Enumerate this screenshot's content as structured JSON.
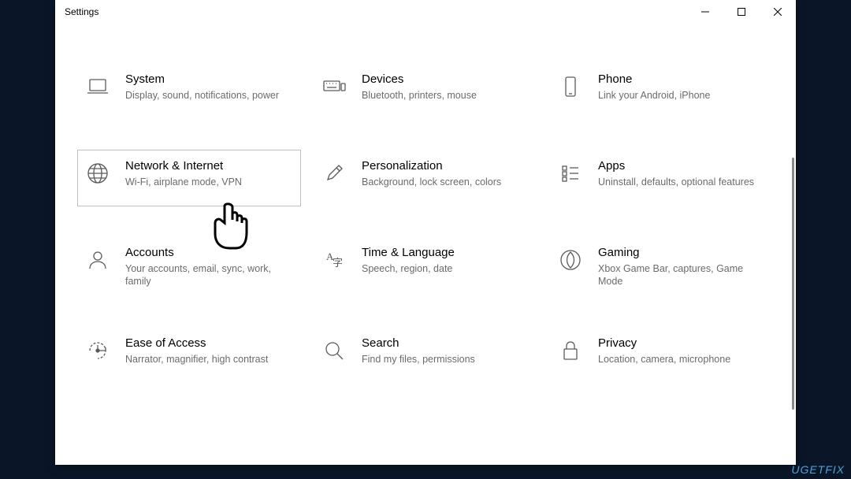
{
  "window": {
    "title": "Settings"
  },
  "tiles": [
    {
      "title": "System",
      "desc": "Display, sound, notifications, power",
      "icon": "laptop-icon"
    },
    {
      "title": "Devices",
      "desc": "Bluetooth, printers, mouse",
      "icon": "keyboard-icon"
    },
    {
      "title": "Phone",
      "desc": "Link your Android, iPhone",
      "icon": "phone-icon"
    },
    {
      "title": "Network & Internet",
      "desc": "Wi-Fi, airplane mode, VPN",
      "icon": "globe-icon",
      "selected": true
    },
    {
      "title": "Personalization",
      "desc": "Background, lock screen, colors",
      "icon": "paintbrush-icon"
    },
    {
      "title": "Apps",
      "desc": "Uninstall, defaults, optional features",
      "icon": "apps-list-icon"
    },
    {
      "title": "Accounts",
      "desc": "Your accounts, email, sync, work, family",
      "icon": "person-icon"
    },
    {
      "title": "Time & Language",
      "desc": "Speech, region, date",
      "icon": "language-icon"
    },
    {
      "title": "Gaming",
      "desc": "Xbox Game Bar, captures, Game Mode",
      "icon": "gaming-icon"
    },
    {
      "title": "Ease of Access",
      "desc": "Narrator, magnifier, high contrast",
      "icon": "ease-of-access-icon"
    },
    {
      "title": "Search",
      "desc": "Find my files, permissions",
      "icon": "search-icon"
    },
    {
      "title": "Privacy",
      "desc": "Location, camera, microphone",
      "icon": "lock-icon"
    }
  ],
  "watermark": "UGETFIX"
}
